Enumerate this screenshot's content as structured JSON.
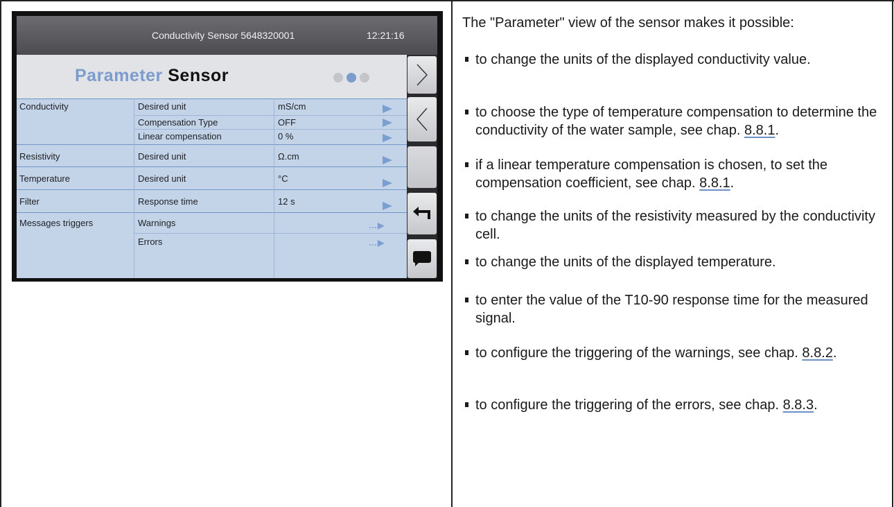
{
  "device": {
    "status_title": "Conductivity Sensor 5648320001",
    "status_time": "12:21:16",
    "title_part1": "Parameter",
    "title_part2": "Sensor",
    "page_dots": 3,
    "active_dot": 2,
    "rows": [
      {
        "group": "Conductivity",
        "param": "Desired unit",
        "value": "mS/cm",
        "action": "arrow"
      },
      {
        "group": "",
        "param": "Compensation Type",
        "value": "OFF",
        "action": "arrow"
      },
      {
        "group": "",
        "param": "Linear compensation",
        "value": "0 %",
        "action": "arrow"
      },
      {
        "group": "Resistivity",
        "param": "Desired unit",
        "value": "Ω.cm",
        "action": "arrow"
      },
      {
        "group": "Temperature",
        "param": "Desired unit",
        "value": "°C",
        "action": "arrow"
      },
      {
        "group": "Filter",
        "param": "Response time",
        "value": "12 s",
        "action": "arrow"
      },
      {
        "group": "Messages triggers",
        "param": "Warnings",
        "value": "",
        "action": "more"
      },
      {
        "group": "",
        "param": "Errors",
        "value": "",
        "action": "more"
      }
    ],
    "side_buttons": [
      "next-icon",
      "previous-icon",
      "",
      "back-icon",
      "message-icon"
    ]
  },
  "doc": {
    "intro": "The \"Parameter\" view of the sensor makes it possible:",
    "items": [
      {
        "pre": "to change the units of the displayed conductivity value.",
        "ref": "",
        "post": ""
      },
      {
        "pre": "to choose the type of temperature compensation to determine the conductivity of the water sample, see chap. ",
        "ref": "8.8.1",
        "post": "."
      },
      {
        "pre": "if a linear temperature compensation is chosen, to set the compensation coefficient, see chap. ",
        "ref": "8.8.1",
        "post": "."
      },
      {
        "pre": "to change the units of the resistivity measured by the conductivity cell.",
        "ref": "",
        "post": ""
      },
      {
        "pre": "to change the units of the displayed temperature.",
        "ref": "",
        "post": ""
      },
      {
        "pre": "to enter the value of the T10-90 response time for the measured signal.",
        "ref": "",
        "post": ""
      },
      {
        "pre": "to configure the triggering of the warnings, see chap. ",
        "ref": "8.8.2",
        "post": "."
      },
      {
        "pre": "to configure the triggering of the errors, see chap. ",
        "ref": "8.8.3",
        "post": "."
      }
    ]
  }
}
